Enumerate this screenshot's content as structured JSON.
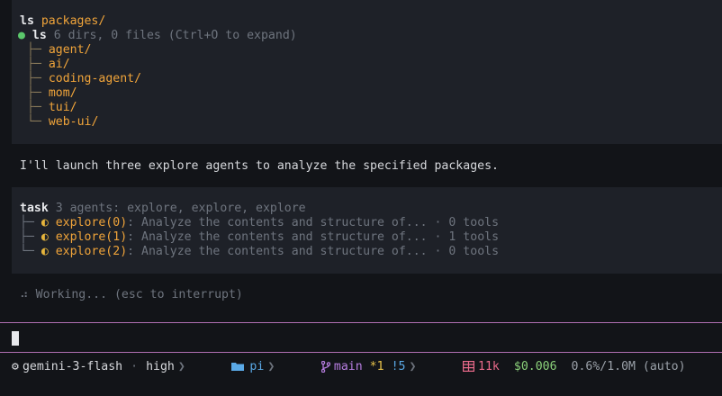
{
  "ls_block": {
    "command": "ls",
    "arg": "packages/",
    "summary_name": "ls",
    "summary_text": "6 dirs, 0 files (Ctrl+O to expand)",
    "items": [
      "agent/",
      "ai/",
      "coding-agent/",
      "mom/",
      "tui/",
      "web-ui/"
    ]
  },
  "message": "I'll launch three explore agents to analyze the specified packages.",
  "task_block": {
    "command": "task",
    "summary": "3 agents: explore, explore, explore",
    "agents": [
      {
        "name": "explore(0)",
        "desc": "Analyze the contents and structure of... · 0 tools"
      },
      {
        "name": "explore(1)",
        "desc": "Analyze the contents and structure of... · 1 tools"
      },
      {
        "name": "explore(2)",
        "desc": "Analyze the contents and structure of... · 0 tools"
      }
    ]
  },
  "working": "Working... (esc to interrupt)",
  "statusbar": {
    "model": "gemini-3-flash",
    "separator": "·",
    "effort": "high",
    "folder": "pi",
    "branch": "main",
    "staged": "*1",
    "modified": "!5",
    "tokens": "11k",
    "cost": "$0.006",
    "context": "0.6%/1.0M (auto)"
  },
  "colors": {
    "accent_orange": "#f0a43a",
    "separator_purple": "#b06fb2",
    "status_green": "#5bc86b"
  }
}
